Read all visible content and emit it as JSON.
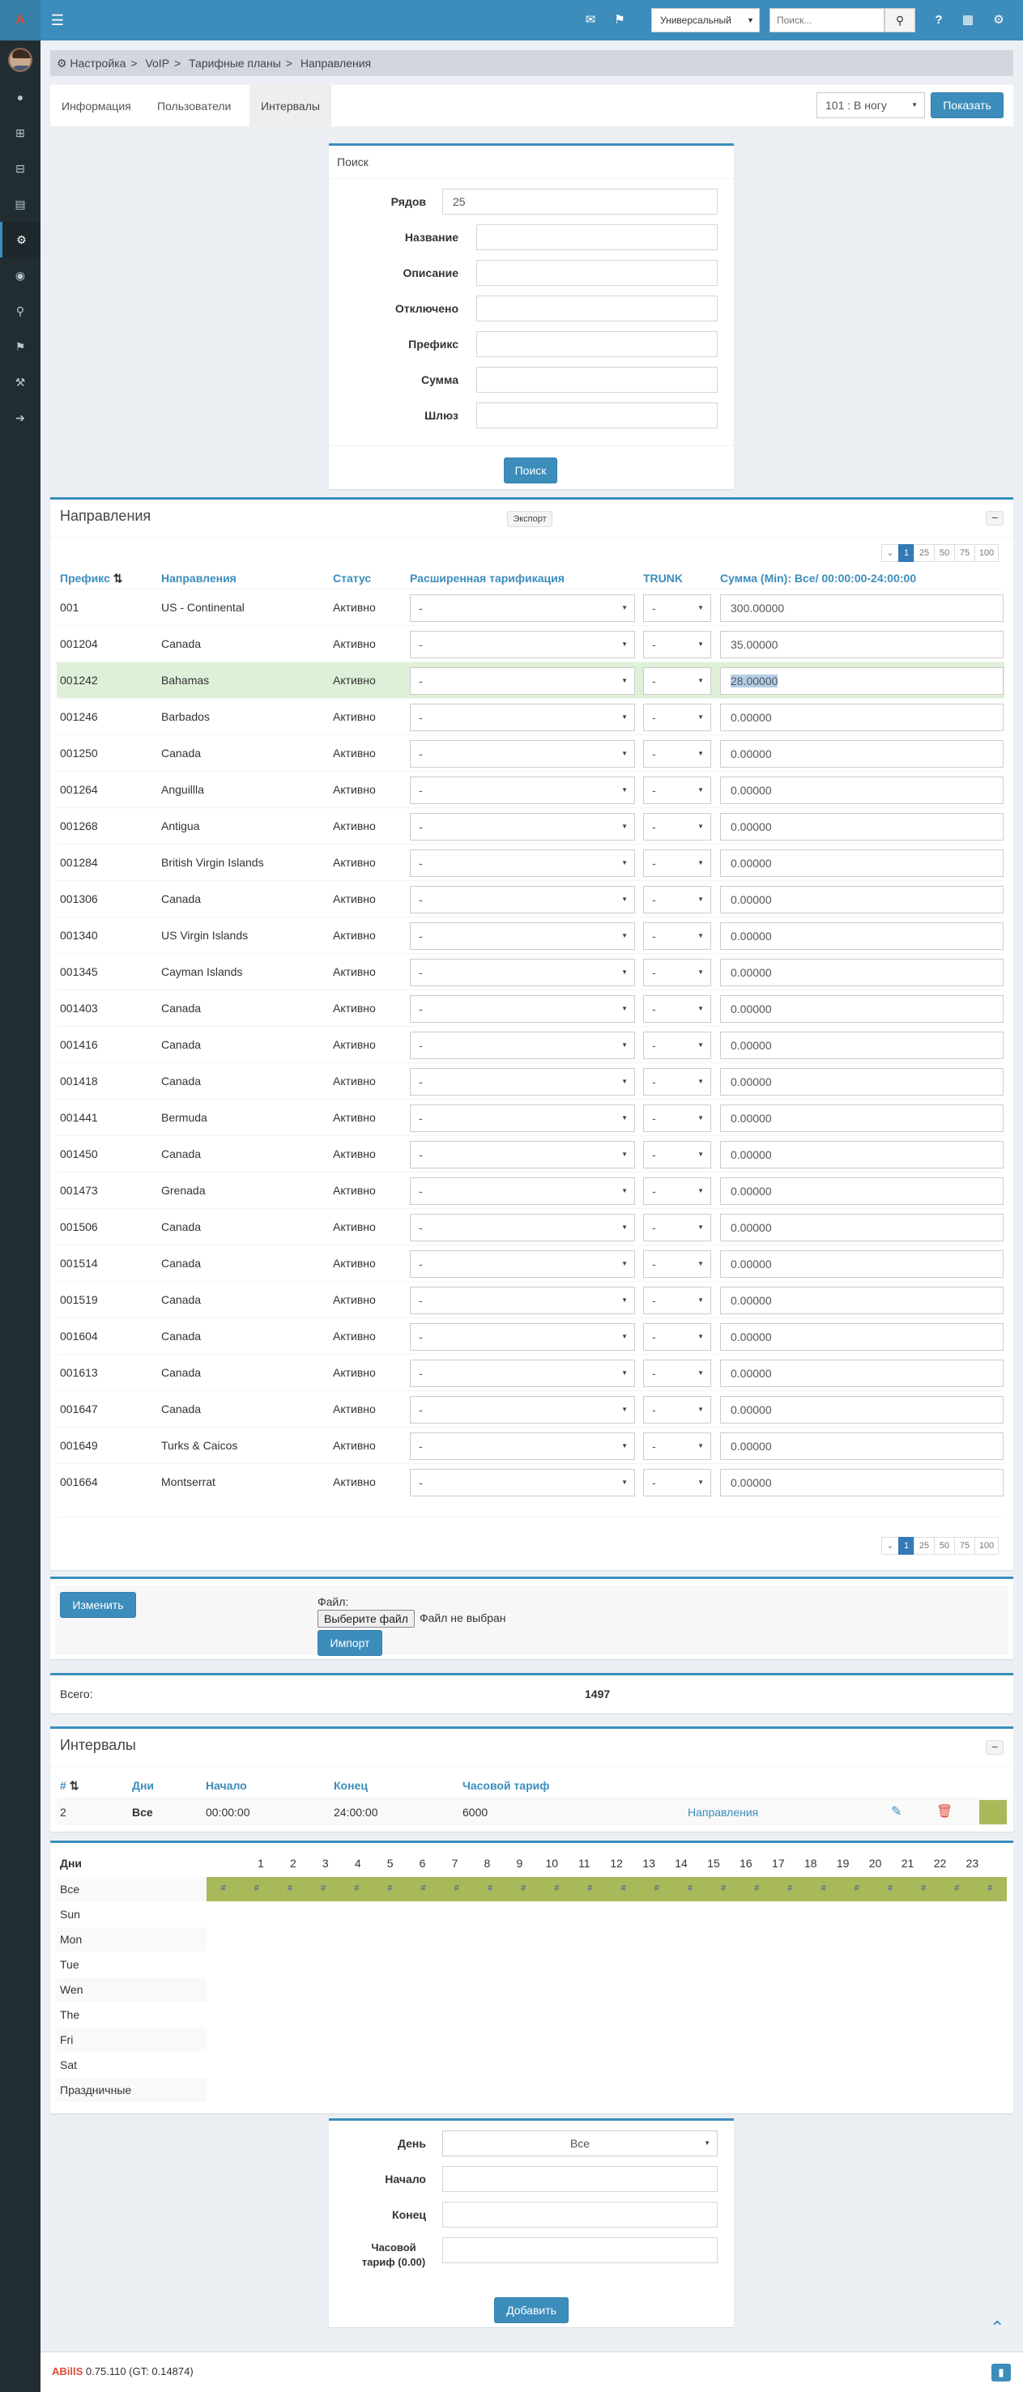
{
  "app": {
    "logo": "A",
    "menu_icon": "menu-icon"
  },
  "topbar": {
    "icons": [
      "mail-icon",
      "flag-icon",
      "question-icon",
      "table-icon",
      "gears-icon"
    ],
    "search_mode": "Универсальный",
    "search_placeholder": "Поиск..."
  },
  "sidebar": {
    "items": [
      "user-icon",
      "plus-square-icon",
      "minus-square-icon",
      "chart-icon",
      "gear-icon",
      "eye-icon",
      "search-icon",
      "flag-icon",
      "wrench-icon",
      "logout-icon"
    ],
    "active_index": 4
  },
  "breadcrumb": [
    "Настройка",
    "VoIP",
    "Тарифные планы",
    "Направления"
  ],
  "tabs": [
    "Информация",
    "Пользователи",
    "Интервалы"
  ],
  "tabs_active": 2,
  "plan_select": "101 : В ногу",
  "show_button": "Показать",
  "search": {
    "title": "Поиск",
    "fields": [
      {
        "label": "Рядов",
        "value": "25"
      },
      {
        "label": "Название",
        "value": ""
      },
      {
        "label": "Описание",
        "value": ""
      },
      {
        "label": "Отключено",
        "value": ""
      },
      {
        "label": "Префикс",
        "value": ""
      },
      {
        "label": "Сумма",
        "value": ""
      },
      {
        "label": "Шлюз",
        "value": ""
      }
    ],
    "button": "Поиск"
  },
  "routes": {
    "title": "Направления",
    "export": "Экспорт",
    "pager": [
      "1",
      "25",
      "50",
      "75",
      "100"
    ],
    "columns": [
      "Префикс",
      "Направления",
      "Статус",
      "Расширенная тарификация",
      "TRUNK",
      "Сумма (Min): Все/ 00:00:00-24:00:00"
    ],
    "select_default": "-",
    "highlight_index": 2,
    "rows": [
      [
        "001",
        "US - Continental",
        "Активно",
        "300.00000"
      ],
      [
        "001204",
        "Canada",
        "Активно",
        "35.00000"
      ],
      [
        "001242",
        "Bahamas",
        "Активно",
        "28.00000"
      ],
      [
        "001246",
        "Barbados",
        "Активно",
        "0.00000"
      ],
      [
        "001250",
        "Canada",
        "Активно",
        "0.00000"
      ],
      [
        "001264",
        "Anguillla",
        "Активно",
        "0.00000"
      ],
      [
        "001268",
        "Antigua",
        "Активно",
        "0.00000"
      ],
      [
        "001284",
        "British Virgin Islands",
        "Активно",
        "0.00000"
      ],
      [
        "001306",
        "Canada",
        "Активно",
        "0.00000"
      ],
      [
        "001340",
        "US Virgin Islands",
        "Активно",
        "0.00000"
      ],
      [
        "001345",
        "Cayman Islands",
        "Активно",
        "0.00000"
      ],
      [
        "001403",
        "Canada",
        "Активно",
        "0.00000"
      ],
      [
        "001416",
        "Canada",
        "Активно",
        "0.00000"
      ],
      [
        "001418",
        "Canada",
        "Активно",
        "0.00000"
      ],
      [
        "001441",
        "Bermuda",
        "Активно",
        "0.00000"
      ],
      [
        "001450",
        "Canada",
        "Активно",
        "0.00000"
      ],
      [
        "001473",
        "Grenada",
        "Активно",
        "0.00000"
      ],
      [
        "001506",
        "Canada",
        "Активно",
        "0.00000"
      ],
      [
        "001514",
        "Canada",
        "Активно",
        "0.00000"
      ],
      [
        "001519",
        "Canada",
        "Активно",
        "0.00000"
      ],
      [
        "001604",
        "Canada",
        "Активно",
        "0.00000"
      ],
      [
        "001613",
        "Canada",
        "Активно",
        "0.00000"
      ],
      [
        "001647",
        "Canada",
        "Активно",
        "0.00000"
      ],
      [
        "001649",
        "Turks & Caicos",
        "Активно",
        "0.00000"
      ],
      [
        "001664",
        "Montserrat",
        "Активно",
        "0.00000"
      ]
    ]
  },
  "actions": {
    "change": "Изменить",
    "file_label": "Файл:",
    "choose_file": "Выберите файл",
    "no_file": "Файл не выбран",
    "import": "Импорт"
  },
  "total": {
    "label": "Всего:",
    "value": "1497"
  },
  "intervals": {
    "title": "Интервалы",
    "columns": [
      "#",
      "Дни",
      "Начало",
      "Конец",
      "Часовой тариф"
    ],
    "rows": [
      {
        "num": "2",
        "days": "Все",
        "start": "00:00:00",
        "end": "24:00:00",
        "rate": "6000",
        "link": "Направления",
        "color": "#a8b95a"
      }
    ]
  },
  "schedule": {
    "header": "Дни",
    "hours": [
      "1",
      "2",
      "3",
      "4",
      "5",
      "6",
      "7",
      "8",
      "9",
      "10",
      "11",
      "12",
      "13",
      "14",
      "15",
      "16",
      "17",
      "18",
      "19",
      "20",
      "21",
      "22",
      "23"
    ],
    "days": [
      "Все",
      "Sun",
      "Mon",
      "Tue",
      "Wen",
      "The",
      "Fri",
      "Sat",
      "Праздничные"
    ],
    "fill_color": "#a8b95a",
    "mark": "#"
  },
  "add_form": {
    "day_label": "День",
    "day_value": "Все",
    "start_label": "Начало",
    "end_label": "Конец",
    "rate_label": "Часовой тариф (0.00)",
    "button": "Добавить"
  },
  "footer": {
    "brand": "ABillS",
    "version": "0.75.110 (GT: 0.14874)"
  }
}
